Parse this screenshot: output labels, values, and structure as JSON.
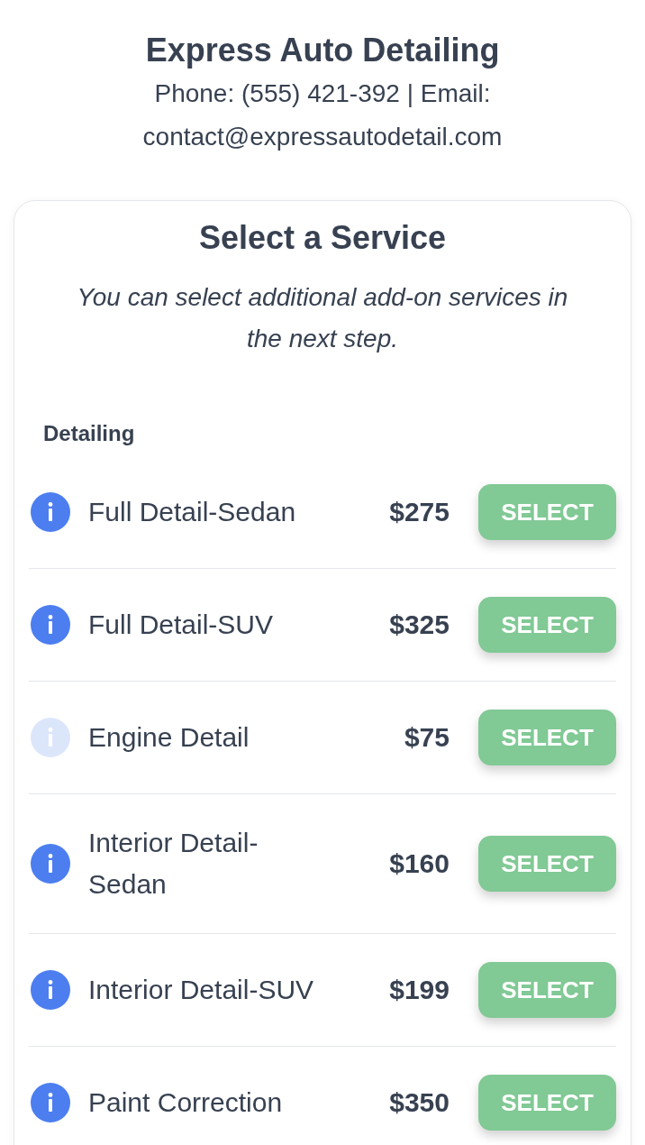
{
  "header": {
    "title": "Express Auto Detailing",
    "contact_line": "Phone: (555) 421-392 | Email: contact@expressautodetail.com"
  },
  "card": {
    "title": "Select a Service",
    "subtitle": "You can select additional add-on services in the next step.",
    "sections": [
      {
        "heading": "Detailing",
        "services": [
          {
            "name": "Full Detail-Sedan",
            "price": "$275",
            "button": "SELECT",
            "info_disabled": false
          },
          {
            "name": "Full Detail-SUV",
            "price": "$325",
            "button": "SELECT",
            "info_disabled": false
          },
          {
            "name": "Engine Detail",
            "price": "$75",
            "button": "SELECT",
            "info_disabled": true
          },
          {
            "name": "Interior Detail-Sedan",
            "price": "$160",
            "button": "SELECT",
            "info_disabled": false
          },
          {
            "name": "Interior Detail-SUV",
            "price": "$199",
            "button": "SELECT",
            "info_disabled": false
          },
          {
            "name": "Paint Correction",
            "price": "$350",
            "button": "SELECT",
            "info_disabled": false
          }
        ]
      }
    ]
  }
}
